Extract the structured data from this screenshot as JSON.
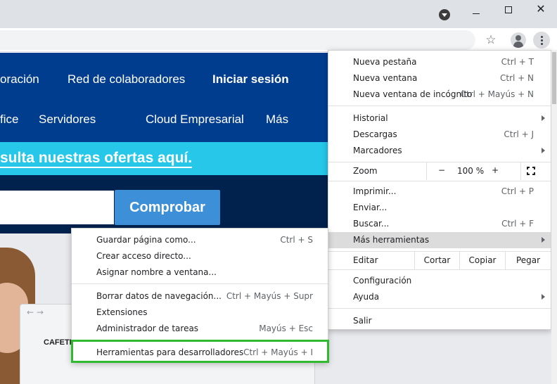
{
  "window": {
    "minimize_icon": "minimize-icon",
    "maximize_icon": "maximize-icon",
    "close_icon": "close-icon",
    "close_glyph": "✕"
  },
  "toolbar": {
    "star_glyph": "☆"
  },
  "page": {
    "nav_row1": [
      "oración",
      "Red de colaboradores",
      "Iniciar sesión"
    ],
    "nav_row2": [
      "fice",
      "Servidores",
      "Cloud Empresarial",
      "Más"
    ],
    "offers": "sulta nuestras ofertas aquí.",
    "search_placeholder": "",
    "check_button": "Comprobar",
    "hero_logo": "CAFETI",
    "hero_browser_nav": "← →"
  },
  "chrome_menu": {
    "group1": [
      {
        "label": "Nueva pestaña",
        "shortcut": "Ctrl + T"
      },
      {
        "label": "Nueva ventana",
        "shortcut": "Ctrl + N"
      },
      {
        "label": "Nueva ventana de incógnito",
        "shortcut": "Ctrl + Mayús + N"
      }
    ],
    "group2": [
      {
        "label": "Historial",
        "shortcut": ""
      },
      {
        "label": "Descargas",
        "shortcut": "Ctrl + J"
      },
      {
        "label": "Marcadores",
        "shortcut": ""
      }
    ],
    "zoom": {
      "label": "Zoom",
      "minus": "−",
      "value": "100 %",
      "plus": "+"
    },
    "group3": [
      {
        "label": "Imprimir...",
        "shortcut": "Ctrl + P"
      },
      {
        "label": "Enviar...",
        "shortcut": ""
      },
      {
        "label": "Buscar...",
        "shortcut": "Ctrl + F"
      },
      {
        "label": "Más herramientas",
        "shortcut": ""
      }
    ],
    "edit": {
      "label": "Editar",
      "cut": "Cortar",
      "copy": "Copiar",
      "paste": "Pegar"
    },
    "group4": [
      {
        "label": "Configuración",
        "shortcut": ""
      },
      {
        "label": "Ayuda",
        "shortcut": ""
      }
    ],
    "exit": {
      "label": "Salir"
    }
  },
  "submenu": {
    "group1": [
      {
        "label": "Guardar página como...",
        "shortcut": "Ctrl + S"
      },
      {
        "label": "Crear acceso directo...",
        "shortcut": ""
      },
      {
        "label": "Asignar nombre a ventana...",
        "shortcut": ""
      }
    ],
    "group2": [
      {
        "label": "Borrar datos de navegación...",
        "shortcut": "Ctrl + Mayús + Supr"
      },
      {
        "label": "Extensiones",
        "shortcut": ""
      },
      {
        "label": "Administrador de tareas",
        "shortcut": "Mayús + Esc"
      }
    ],
    "devtools": {
      "label": "Herramientas para desarrolladores",
      "shortcut": "Ctrl + Mayús + I"
    }
  },
  "colors": {
    "nav_blue": "#003d8f",
    "offers_cyan": "#26c7e8",
    "search_navy": "#02224e",
    "button_blue": "#3d8fd8",
    "highlight_green": "#2fba2f",
    "menu_hover": "#dcdcdc"
  }
}
